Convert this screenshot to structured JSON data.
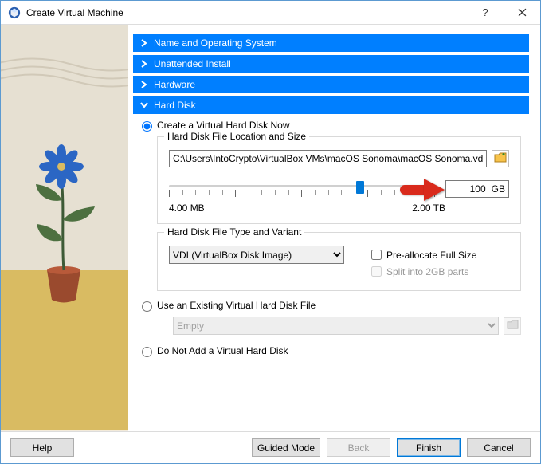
{
  "window": {
    "title": "Create Virtual Machine"
  },
  "steps": {
    "name": "Name and Operating System",
    "unattended": "Unattended Install",
    "hardware": "Hardware",
    "harddisk": "Hard Disk"
  },
  "harddisk": {
    "radio_create": "Create a Virtual Hard Disk Now",
    "radio_existing": "Use an Existing Virtual Hard Disk File",
    "radio_none": "Do Not Add a Virtual Hard Disk",
    "group_location": "Hard Disk File Location and Size",
    "file_path": "C:\\Users\\IntoCrypto\\VirtualBox VMs\\macOS Sonoma\\macOS Sonoma.vdi",
    "size_value": "100",
    "size_unit": "GB",
    "slider_min": "4.00 MB",
    "slider_max": "2.00 TB",
    "group_type": "Hard Disk File Type and Variant",
    "type_selected": "VDI (VirtualBox Disk Image)",
    "check_prealloc": "Pre-allocate Full Size",
    "check_split": "Split into 2GB parts",
    "existing_selected": "Empty"
  },
  "footer": {
    "help": "Help",
    "guided": "Guided Mode",
    "back": "Back",
    "finish": "Finish",
    "cancel": "Cancel"
  },
  "icons": {
    "app": "cube-icon",
    "help_q": "?"
  }
}
